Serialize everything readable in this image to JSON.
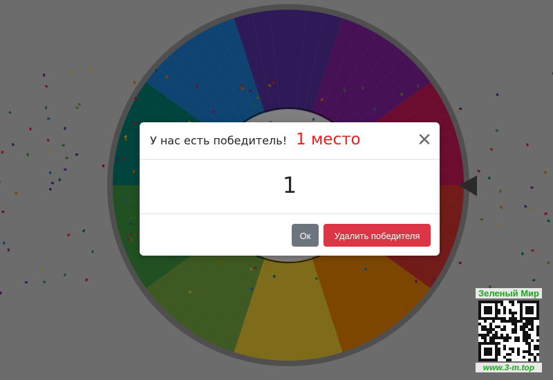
{
  "modal": {
    "title": "У нас есть победитель!",
    "place": "1 место",
    "close_symbol": "✕",
    "winner": "1",
    "ok_label": "Ок",
    "delete_label": "Удалить победителя"
  },
  "wheel": {
    "segment_colors": [
      "#e53935",
      "#fb8c00",
      "#fdd835",
      "#7cb342",
      "#43a047",
      "#00897b",
      "#1e88e5",
      "#5e35b1",
      "#8e24aa",
      "#d81b60"
    ],
    "pointer_color": "#555555"
  },
  "badge": {
    "title": "Зеленый Мир",
    "url": "www.3-m.top"
  },
  "colors": {
    "danger": "#dc3545",
    "secondary": "#6c757d",
    "place_red": "#ee1c1c",
    "badge_green": "#1aa81a"
  }
}
